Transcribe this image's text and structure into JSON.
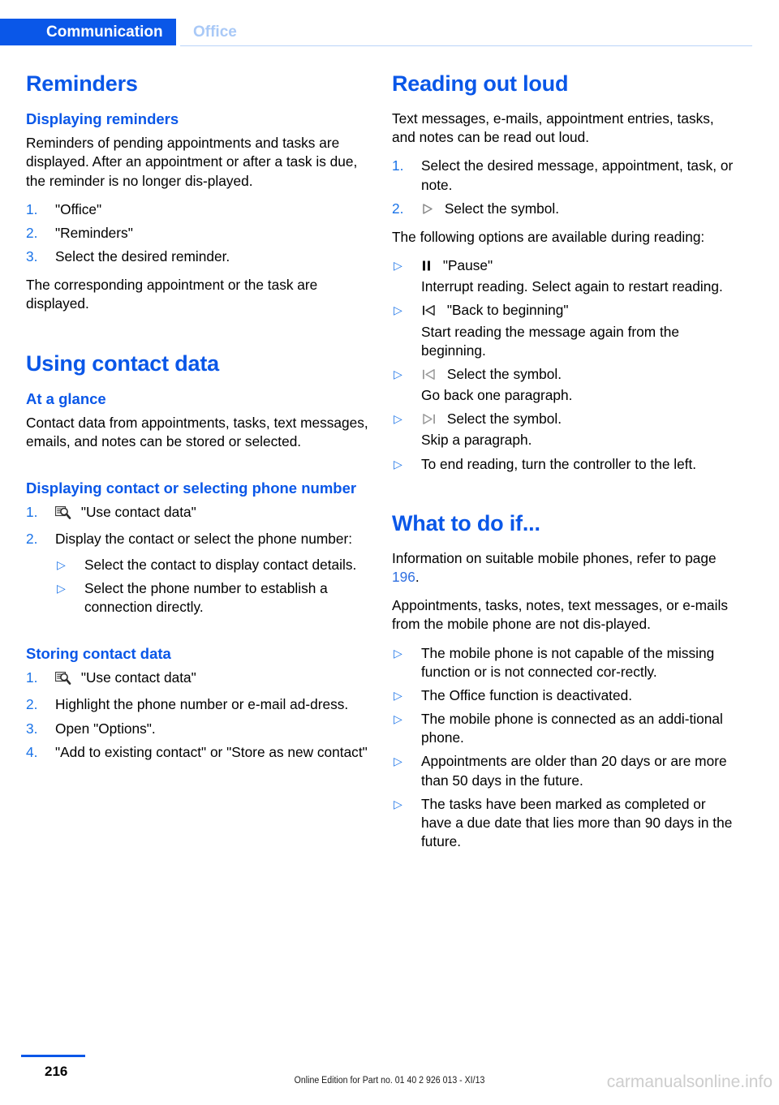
{
  "header": {
    "active_tab": "Communication",
    "inactive_tab": "Office",
    "accent_color": "#0a57e8",
    "inactive_color": "#a9c9f7"
  },
  "left_column": {
    "section1": {
      "title": "Reminders",
      "subheading": "Displaying reminders",
      "intro": "Reminders of pending appointments and tasks are displayed. After an appointment or after a task is due, the reminder is no longer dis-played.",
      "steps": [
        {
          "num": "1.",
          "text": "\"Office\""
        },
        {
          "num": "2.",
          "text": "\"Reminders\""
        },
        {
          "num": "3.",
          "text": "Select the desired reminder."
        }
      ],
      "outro": "The corresponding appointment or the task are displayed."
    },
    "section2": {
      "title": "Using contact data",
      "sub1": {
        "heading": "At a glance",
        "text": "Contact data from appointments, tasks, text messages, emails, and notes can be stored or selected."
      },
      "sub2": {
        "heading": "Displaying contact or selecting phone number",
        "step1_icon": "contact-search-icon",
        "step1_num": "1.",
        "step1_text": "\"Use contact data\"",
        "step2_num": "2.",
        "step2_text": "Display the contact or select the phone number:",
        "bullets": [
          "Select the contact to display contact details.",
          "Select the phone number to establish a connection directly."
        ]
      },
      "sub3": {
        "heading": "Storing contact data",
        "steps": [
          {
            "num": "1.",
            "icon": "contact-search-icon",
            "text": "\"Use contact data\""
          },
          {
            "num": "2.",
            "icon": "",
            "text": "Highlight the phone number or e-mail ad-dress."
          },
          {
            "num": "3.",
            "icon": "",
            "text": "Open \"Options\"."
          },
          {
            "num": "4.",
            "icon": "",
            "text": "\"Add to existing contact\" or \"Store as new contact\""
          }
        ]
      }
    }
  },
  "right_column": {
    "section1": {
      "title": "Reading out loud",
      "intro": "Text messages, e-mails, appointment entries, tasks, and notes can be read out loud.",
      "steps": [
        {
          "num": "1.",
          "icon": "",
          "text": "Select the desired message, appointment, task, or note."
        },
        {
          "num": "2.",
          "icon": "play-icon",
          "text": "Select the symbol."
        }
      ],
      "options_intro": "The following options are available during reading:",
      "options": [
        {
          "icon": "pause-icon",
          "label": "\"Pause\"",
          "note": "Interrupt reading. Select again to restart reading."
        },
        {
          "icon": "skip-start-icon",
          "label": "\"Back to beginning\"",
          "note": "Start reading the message again from the beginning."
        },
        {
          "icon": "previous-icon",
          "label": "Select the symbol.",
          "note": "Go back one paragraph."
        },
        {
          "icon": "next-icon",
          "label": "Select the symbol.",
          "note": "Skip a paragraph."
        },
        {
          "icon": "",
          "label": "To end reading, turn the controller to the left.",
          "note": ""
        }
      ]
    },
    "section2": {
      "title": "What to do if...",
      "para1_pre": "Information on suitable mobile phones, refer to page ",
      "para1_pageref": "196",
      "para1_post": ".",
      "para2": "Appointments, tasks, notes, text messages, or e-mails from the mobile phone are not dis-played.",
      "bullets": [
        "The mobile phone is not capable of the missing function or is not connected cor-rectly.",
        "The Office function is deactivated.",
        "The mobile phone is connected as an addi-tional phone.",
        "Appointments are older than 20 days or are more than 50 days in the future.",
        "The tasks have been marked as completed or have a due date that lies more than 90 days in the future."
      ]
    }
  },
  "footer": {
    "page_number": "216",
    "edition_text": "Online Edition for Part no. 01 40 2 926 013 - XI/13",
    "watermark": "carmanualsonline.info"
  }
}
